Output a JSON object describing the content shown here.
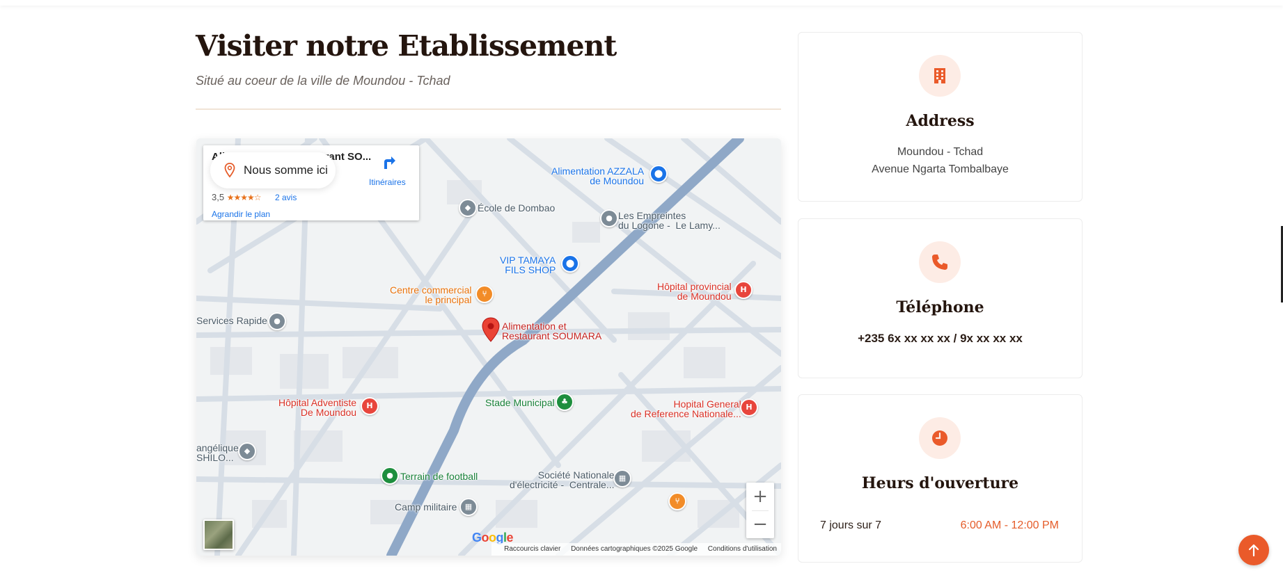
{
  "section": {
    "title": "Visiter notre Etablissement",
    "subtitle": "Situé au coeur de la ville de Moundou - Tchad"
  },
  "map": {
    "place_card": {
      "title": "Alimentation et Restaurant SO...",
      "rating": "3,5",
      "stars": "★★★★☆",
      "reviews": "2 avis",
      "enlarge_link": "Agrandir le plan",
      "directions_label": "Itinéraires"
    },
    "here_pill": "Nous somme ici",
    "labels": {
      "alimentation_azzala": "Alimentation AZZALA\nde Moundou",
      "ecole_dombao": "École de Dombao",
      "empreintes": "Les Empreintes\ndu Logone -  Le Lamy...",
      "vip_tamaya": "VIP TAMAYA\nFILS SHOP",
      "centre_commercial": "Centre commercial\nle principal",
      "hopital_provincial": "Hôpital provincial\nde Moundou",
      "services_rapide": "Services Rapide",
      "soumara": "Alimentation et\nRestaurant SOUMARA",
      "hopital_adventiste": "Hôpital Adventiste\nDe Moundou",
      "stade_municipal": "Stade Municipal",
      "hopital_general": "Hopital General\nde Reference Nationale...",
      "evangelique": "angélique\nSHILO...",
      "terrain_football": "Terrain de football",
      "societe_nationale": "Société Nationale\nd'électricité -  Centrale...",
      "camp_militaire": "Camp militaire"
    },
    "zoom_in": "+",
    "zoom_out": "−",
    "google_logo": "Google",
    "attribution": {
      "shortcuts": "Raccourcis clavier",
      "data": "Données cartographiques ©2025 Google",
      "terms": "Conditions d'utilisation"
    },
    "colors": {
      "road_main": "#8fa8c7",
      "road_minor": "#d5dde6",
      "medical": "#e8453c",
      "shopping": "#1a73e8",
      "food": "#f28c28",
      "park": "#1e8e3e",
      "generic": "#7d8b96"
    }
  },
  "cards": {
    "address": {
      "icon": "building-icon",
      "title": "Address",
      "line1": "Moundou - Tchad",
      "line2": "Avenue Ngarta Tombalbaye"
    },
    "phone": {
      "icon": "phone-icon",
      "title": "Téléphone",
      "number": "+235 6x xx xx xx / 9x xx xx xx"
    },
    "hours": {
      "icon": "clock-icon",
      "title": "Heurs d'ouverture",
      "days": "7 jours sur 7",
      "time": "6:00 AM - 12:00 PM"
    }
  },
  "accent_color": "#ea5a2a"
}
